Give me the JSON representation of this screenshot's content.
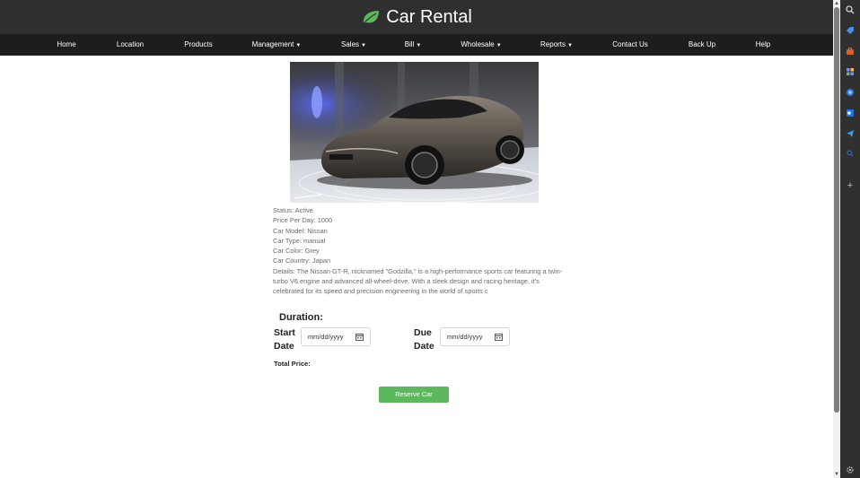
{
  "header": {
    "brand": "Car Rental",
    "brand_icon": "leaf-icon",
    "brand_color": "#5cb85c"
  },
  "nav": {
    "items": [
      {
        "label": "Home",
        "dropdown": false
      },
      {
        "label": "Location",
        "dropdown": false
      },
      {
        "label": "Products",
        "dropdown": false
      },
      {
        "label": "Management",
        "dropdown": true
      },
      {
        "label": "Sales",
        "dropdown": true
      },
      {
        "label": "Bill",
        "dropdown": true
      },
      {
        "label": "Wholesale",
        "dropdown": true
      },
      {
        "label": "Reports",
        "dropdown": true
      },
      {
        "label": "Contact Us",
        "dropdown": false
      },
      {
        "label": "Back Up",
        "dropdown": false
      },
      {
        "label": "Help",
        "dropdown": false
      }
    ]
  },
  "car": {
    "status": "Status: Active",
    "price": "Price Per Day: 1000",
    "model": "Car Model: Nissan",
    "type": "Car Type: manual",
    "color": "Car Color: Grey",
    "country": "Car Country: Japan",
    "details": "Details: The Nissan GT-R, nicknamed \"Godzilla,\" is a high-performance sports car featuring a twin-turbo V6 engine and advanced all-wheel-drive. With a sleek design and racing heritage, it's celebrated for its speed and precision engineering in the world of sports c"
  },
  "booking": {
    "duration_title": "Duration:",
    "start_label": "Start Date",
    "due_label": "Due Date",
    "start_placeholder": "mm/dd/yyyy",
    "due_placeholder": "mm/dd/yyyy",
    "total_label": "Total Price:",
    "reserve_label": "Reserve Car",
    "reserve_color": "#5cb85c"
  },
  "browser_sidebar": {
    "icons": [
      "search-icon",
      "tag-icon",
      "briefcase-icon",
      "games-icon",
      "copilot-icon",
      "outlook-icon",
      "telegram-icon",
      "search-small-icon",
      "add-icon",
      "settings-icon"
    ]
  }
}
